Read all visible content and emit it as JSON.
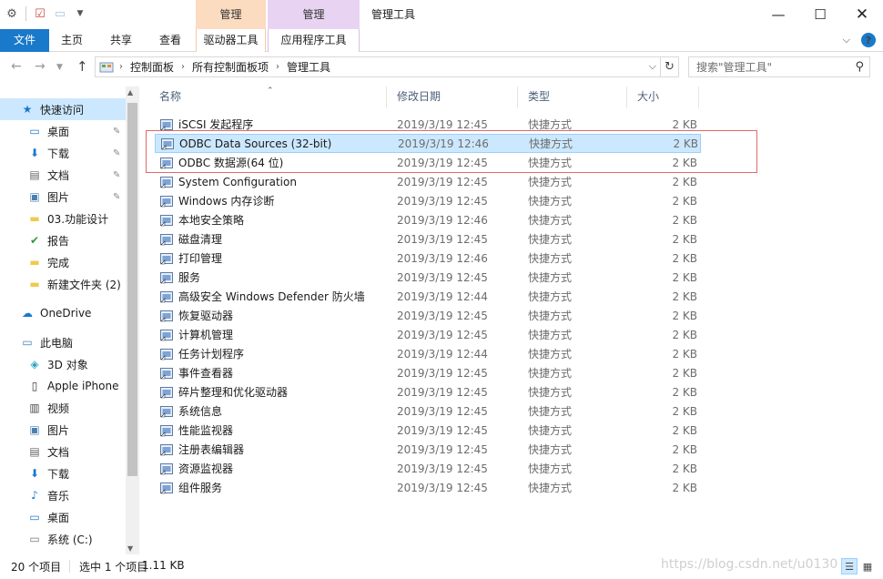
{
  "window": {
    "title": "管理工具",
    "context_tab_orange": "管理",
    "context_tab_purple": "管理"
  },
  "ribbon": {
    "tabs": [
      "文件",
      "主页",
      "共享",
      "查看",
      "驱动器工具",
      "应用程序工具"
    ]
  },
  "address": {
    "crumbs": [
      "控制面板",
      "所有控制面板项",
      "管理工具"
    ],
    "search_placeholder": "搜索\"管理工具\""
  },
  "nav": {
    "items": [
      {
        "label": "快速访问",
        "icon": "star-icon",
        "pinned": false
      },
      {
        "label": "桌面",
        "icon": "desktop-icon",
        "pinned": true
      },
      {
        "label": "下载",
        "icon": "download-icon",
        "pinned": true
      },
      {
        "label": "文档",
        "icon": "document-icon",
        "pinned": true
      },
      {
        "label": "图片",
        "icon": "picture-icon",
        "pinned": true
      },
      {
        "label": "03.功能设计",
        "icon": "folder-icon",
        "pinned": false
      },
      {
        "label": "报告",
        "icon": "folder-check-icon",
        "pinned": false
      },
      {
        "label": "完成",
        "icon": "folder-icon",
        "pinned": false
      },
      {
        "label": "新建文件夹 (2)",
        "icon": "folder-icon",
        "pinned": false
      },
      {
        "label": "OneDrive",
        "icon": "cloud-icon",
        "pinned": false
      },
      {
        "label": "此电脑",
        "icon": "computer-icon",
        "pinned": false
      },
      {
        "label": "3D 对象",
        "icon": "cube-icon",
        "pinned": false
      },
      {
        "label": "Apple iPhone",
        "icon": "phone-icon",
        "pinned": false
      },
      {
        "label": "视频",
        "icon": "video-icon",
        "pinned": false
      },
      {
        "label": "图片",
        "icon": "picture-icon",
        "pinned": false
      },
      {
        "label": "文档",
        "icon": "document-icon",
        "pinned": false
      },
      {
        "label": "下载",
        "icon": "download-icon",
        "pinned": false
      },
      {
        "label": "音乐",
        "icon": "music-icon",
        "pinned": false
      },
      {
        "label": "桌面",
        "icon": "desktop-icon",
        "pinned": false
      },
      {
        "label": "系统 (C:)",
        "icon": "drive-icon",
        "pinned": false
      }
    ]
  },
  "columns": {
    "name": "名称",
    "date": "修改日期",
    "type": "类型",
    "size": "大小"
  },
  "files": [
    {
      "name": "iSCSI 发起程序",
      "date": "2019/3/19 12:45",
      "type": "快捷方式",
      "size": "2 KB",
      "selected": false
    },
    {
      "name": "ODBC Data Sources (32-bit)",
      "date": "2019/3/19 12:46",
      "type": "快捷方式",
      "size": "2 KB",
      "selected": true
    },
    {
      "name": "ODBC 数据源(64 位)",
      "date": "2019/3/19 12:45",
      "type": "快捷方式",
      "size": "2 KB",
      "selected": false
    },
    {
      "name": "System Configuration",
      "date": "2019/3/19 12:45",
      "type": "快捷方式",
      "size": "2 KB",
      "selected": false
    },
    {
      "name": "Windows 内存诊断",
      "date": "2019/3/19 12:45",
      "type": "快捷方式",
      "size": "2 KB",
      "selected": false
    },
    {
      "name": "本地安全策略",
      "date": "2019/3/19 12:46",
      "type": "快捷方式",
      "size": "2 KB",
      "selected": false
    },
    {
      "name": "磁盘清理",
      "date": "2019/3/19 12:45",
      "type": "快捷方式",
      "size": "2 KB",
      "selected": false
    },
    {
      "name": "打印管理",
      "date": "2019/3/19 12:46",
      "type": "快捷方式",
      "size": "2 KB",
      "selected": false
    },
    {
      "name": "服务",
      "date": "2019/3/19 12:45",
      "type": "快捷方式",
      "size": "2 KB",
      "selected": false
    },
    {
      "name": "高级安全 Windows Defender 防火墙",
      "date": "2019/3/19 12:44",
      "type": "快捷方式",
      "size": "2 KB",
      "selected": false
    },
    {
      "name": "恢复驱动器",
      "date": "2019/3/19 12:45",
      "type": "快捷方式",
      "size": "2 KB",
      "selected": false
    },
    {
      "name": "计算机管理",
      "date": "2019/3/19 12:45",
      "type": "快捷方式",
      "size": "2 KB",
      "selected": false
    },
    {
      "name": "任务计划程序",
      "date": "2019/3/19 12:44",
      "type": "快捷方式",
      "size": "2 KB",
      "selected": false
    },
    {
      "name": "事件查看器",
      "date": "2019/3/19 12:45",
      "type": "快捷方式",
      "size": "2 KB",
      "selected": false
    },
    {
      "name": "碎片整理和优化驱动器",
      "date": "2019/3/19 12:45",
      "type": "快捷方式",
      "size": "2 KB",
      "selected": false
    },
    {
      "name": "系统信息",
      "date": "2019/3/19 12:45",
      "type": "快捷方式",
      "size": "2 KB",
      "selected": false
    },
    {
      "name": "性能监视器",
      "date": "2019/3/19 12:45",
      "type": "快捷方式",
      "size": "2 KB",
      "selected": false
    },
    {
      "name": "注册表编辑器",
      "date": "2019/3/19 12:45",
      "type": "快捷方式",
      "size": "2 KB",
      "selected": false
    },
    {
      "name": "资源监视器",
      "date": "2019/3/19 12:45",
      "type": "快捷方式",
      "size": "2 KB",
      "selected": false
    },
    {
      "name": "组件服务",
      "date": "2019/3/19 12:45",
      "type": "快捷方式",
      "size": "2 KB",
      "selected": false
    }
  ],
  "status": {
    "count": "20 个项目",
    "selected": "选中 1 个项目",
    "size": "1.11 KB",
    "watermark": "https://blog.csdn.net/u0130"
  },
  "colors": {
    "accent": "#1979ca",
    "selection": "#cce8ff",
    "highlight_box": "#e06a6a"
  }
}
